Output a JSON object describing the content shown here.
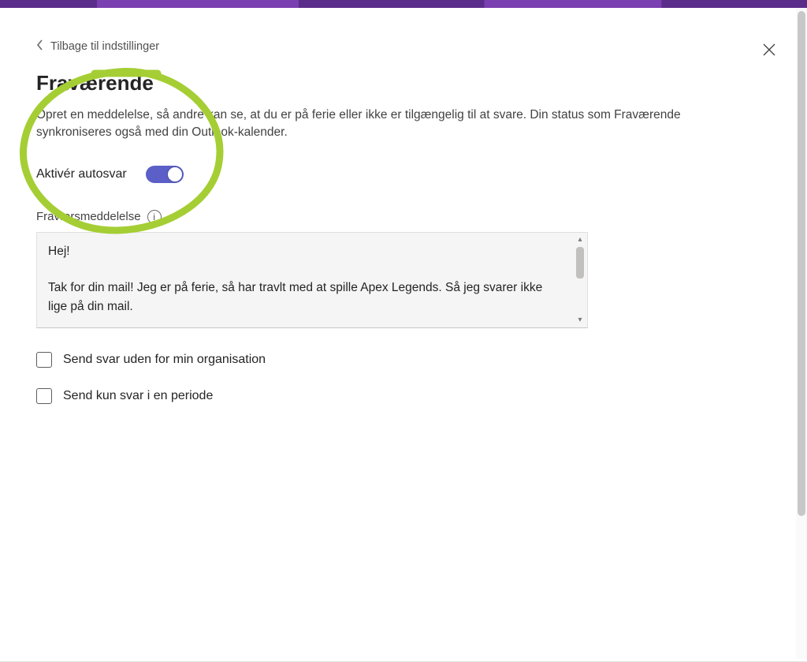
{
  "colors": {
    "accent": "#5b5fc7",
    "highlight": "#a5ce34"
  },
  "header": {
    "back_label": "Tilbage til indstillinger",
    "title": "Fraværende"
  },
  "description": "Opret en meddelelse, så andre kan se, at du er på ferie eller ikke er tilgængelig til at svare. Din status som Fraværende synkroniseres også med din Outlook-kalender.",
  "autosvar": {
    "toggle_label": "Aktivér autosvar",
    "enabled": true
  },
  "message": {
    "section_label": "Fraværsmeddelelse",
    "text": "Hej!\n\nTak for din mail! Jeg er på ferie, så har travlt med at spille Apex Legends. Så jeg svarer ikke lige på din mail."
  },
  "options": {
    "outside_org": "Send svar uden for min organisation",
    "period_only": "Send kun svar i en periode"
  },
  "icons": {
    "back": "chevron-left-icon",
    "close": "close-icon",
    "info": "info-icon",
    "scroll_up": "scroll-up-icon",
    "scroll_down": "scroll-down-icon"
  }
}
